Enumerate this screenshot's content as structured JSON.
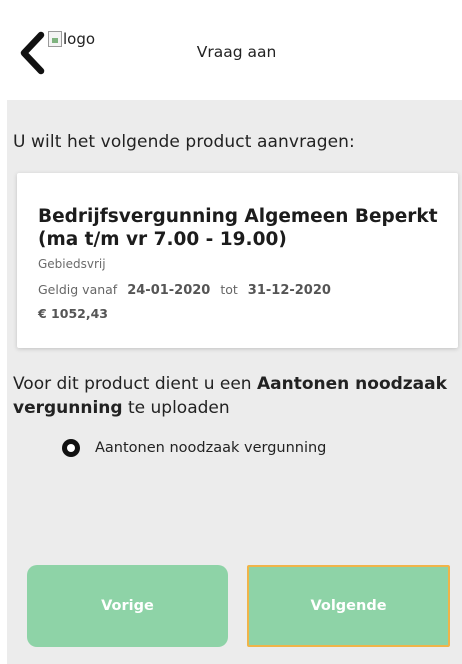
{
  "header": {
    "back_icon": "chevron-left-icon",
    "logo_alt": "logo",
    "title": "Vraag aan"
  },
  "intro": "U wilt het volgende product aanvragen:",
  "product": {
    "name_line1": "Bedrijfsvergunning Algemeen Beperkt",
    "name_line2": "(ma t/m vr 7.00 - 19.00)",
    "area": "Gebiedsvrij",
    "valid_from_label": "Geldig vanaf",
    "valid_from": "24-01-2020",
    "valid_to_label": "tot",
    "valid_to": "31-12-2020",
    "price": "€ 1052,43"
  },
  "notice": {
    "prefix": "Voor dit product dient u een ",
    "emphasis": "Aantonen noodzaak vergunning",
    "suffix": " te uploaden"
  },
  "upload_option": {
    "label": "Aantonen noodzaak vergunning",
    "selected": true
  },
  "buttons": {
    "previous": "Vorige",
    "next": "Volgende"
  },
  "colors": {
    "button_green": "#8ed3a7",
    "focus_outline": "#f0b449",
    "background": "#ececec"
  }
}
